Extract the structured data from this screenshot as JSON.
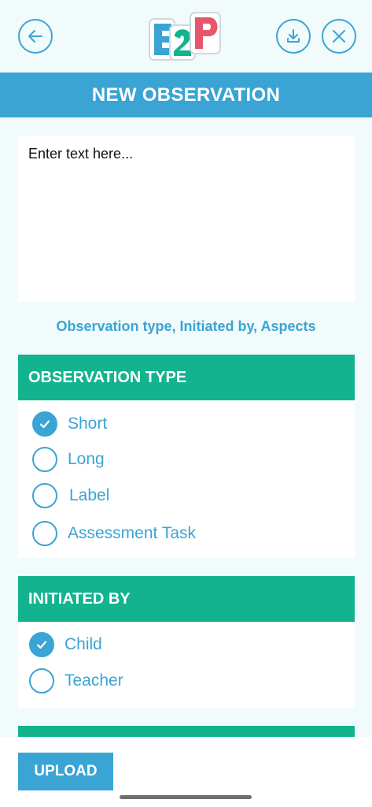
{
  "header": {
    "back_icon": "arrow-left-icon",
    "download_icon": "download-icon",
    "close_icon": "close-icon",
    "logo": {
      "letters": [
        "E",
        "2",
        "P"
      ],
      "colors": {
        "E": "#3aa4d4",
        "2": "#12b38e",
        "P": "#e8566b"
      }
    }
  },
  "title": "NEW OBSERVATION",
  "text_input": {
    "placeholder": "Enter text here..."
  },
  "hint": "Observation type, Initiated by, Aspects",
  "sections": {
    "observation_type": {
      "title": "OBSERVATION TYPE",
      "options": [
        {
          "label": "Short",
          "checked": true
        },
        {
          "label": "Long",
          "checked": false
        },
        {
          "label": "Label",
          "checked": false
        },
        {
          "label": "Assessment Task",
          "checked": false
        }
      ]
    },
    "initiated_by": {
      "title": "INITIATED BY",
      "options": [
        {
          "label": "Child",
          "checked": true
        },
        {
          "label": "Teacher",
          "checked": false
        }
      ]
    }
  },
  "footer": {
    "upload_label": "UPLOAD"
  },
  "colors": {
    "primary": "#3aa4d4",
    "section": "#12b38e",
    "background": "#f1fbfc"
  }
}
